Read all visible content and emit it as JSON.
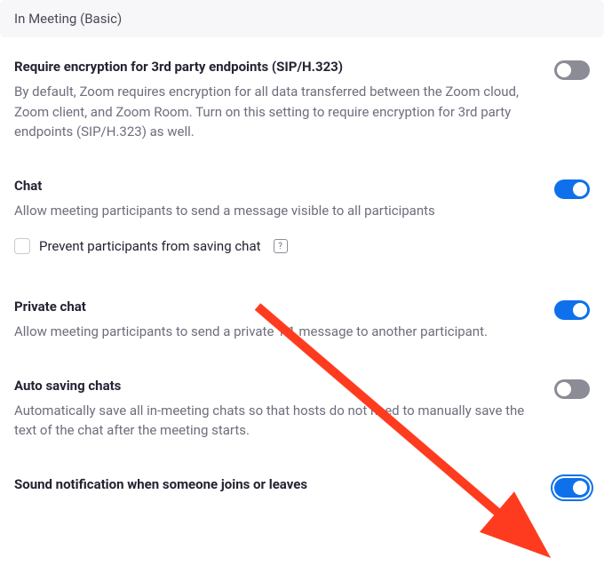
{
  "section": {
    "header": "In Meeting (Basic)"
  },
  "settings": [
    {
      "title": "Require encryption for 3rd party endpoints (SIP/H.323)",
      "desc": "By default, Zoom requires encryption for all data transferred between the Zoom cloud, Zoom client, and Zoom Room. Turn on this setting to require encryption for 3rd party endpoints (SIP/H.323) as well.",
      "enabled": false,
      "focused": false
    },
    {
      "title": "Chat",
      "desc": "Allow meeting participants to send a message visible to all participants",
      "enabled": true,
      "focused": false,
      "sub": {
        "label": "Prevent participants from saving chat",
        "checked": false
      }
    },
    {
      "title": "Private chat",
      "desc": "Allow meeting participants to send a private 1:1 message to another participant.",
      "enabled": true,
      "focused": false
    },
    {
      "title": "Auto saving chats",
      "desc": "Automatically save all in-meeting chats so that hosts do not need to manually save the text of the chat after the meeting starts.",
      "enabled": false,
      "focused": false
    },
    {
      "title": "Sound notification when someone joins or leaves",
      "desc": "",
      "enabled": true,
      "focused": true
    }
  ],
  "annotation": {
    "arrow_color": "#ff3b1f"
  }
}
